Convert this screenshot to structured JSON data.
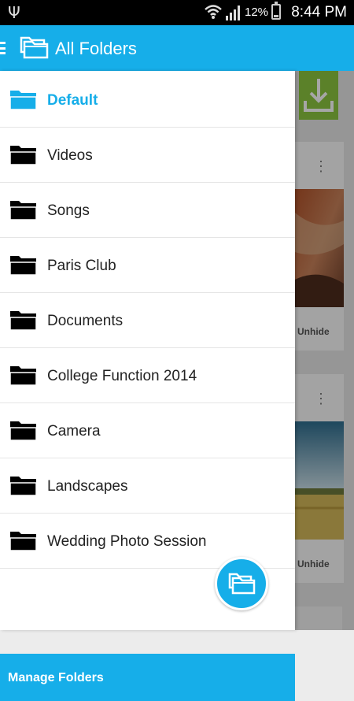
{
  "status_bar": {
    "battery_percent": "12%",
    "time": "8:44 PM",
    "icons": [
      "usb-icon",
      "wifi-icon",
      "signal-icon",
      "battery-charging-icon"
    ]
  },
  "app_bar": {
    "title": "All Folders",
    "icons": [
      "menu-icon",
      "folders-icon"
    ]
  },
  "drawer": {
    "folders": [
      {
        "label": "Default",
        "active": true
      },
      {
        "label": "Videos",
        "active": false
      },
      {
        "label": "Songs",
        "active": false
      },
      {
        "label": "Paris Club",
        "active": false
      },
      {
        "label": "Documents",
        "active": false
      },
      {
        "label": "College Function 2014",
        "active": false
      },
      {
        "label": "Camera",
        "active": false
      },
      {
        "label": "Landscapes",
        "active": false
      },
      {
        "label": "Wedding Photo Session",
        "active": false
      }
    ],
    "manage_label": "Manage Folders"
  },
  "background": {
    "cards": [
      {
        "action": "Unhide"
      },
      {
        "action": "Unhide"
      }
    ]
  },
  "colors": {
    "accent": "#16aee9",
    "download_button": "#8cc63f"
  }
}
